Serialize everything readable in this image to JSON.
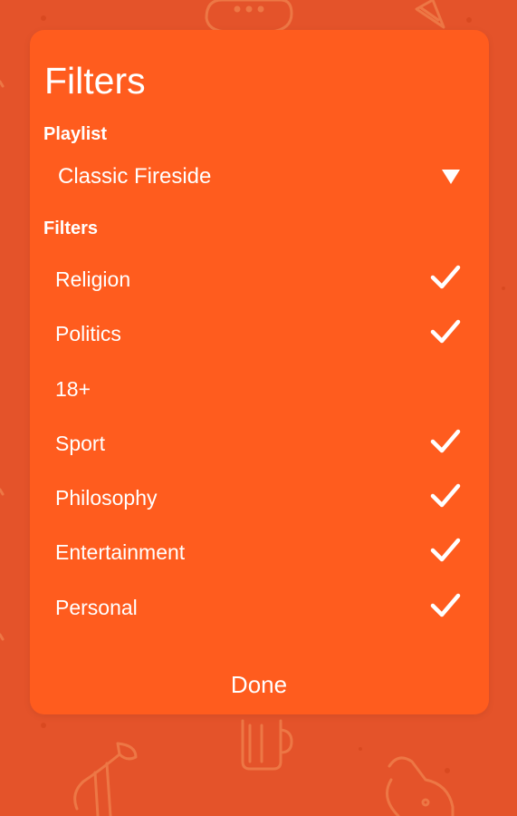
{
  "dialog": {
    "title": "Filters",
    "playlist_label": "Playlist",
    "playlist_value": "Classic Fireside",
    "filters_label": "Filters",
    "done_label": "Done"
  },
  "filters": [
    {
      "label": "Religion",
      "checked": true
    },
    {
      "label": "Politics",
      "checked": true
    },
    {
      "label": "18+",
      "checked": false
    },
    {
      "label": "Sport",
      "checked": true
    },
    {
      "label": "Philosophy",
      "checked": true
    },
    {
      "label": "Entertainment",
      "checked": true
    },
    {
      "label": "Personal",
      "checked": true
    }
  ],
  "icons": {
    "dropdown": "triangle-down-icon",
    "check": "checkmark-icon"
  },
  "colors": {
    "background": "#E4532A",
    "dialog": "#FF5C1E",
    "text": "#FFFFFF"
  }
}
